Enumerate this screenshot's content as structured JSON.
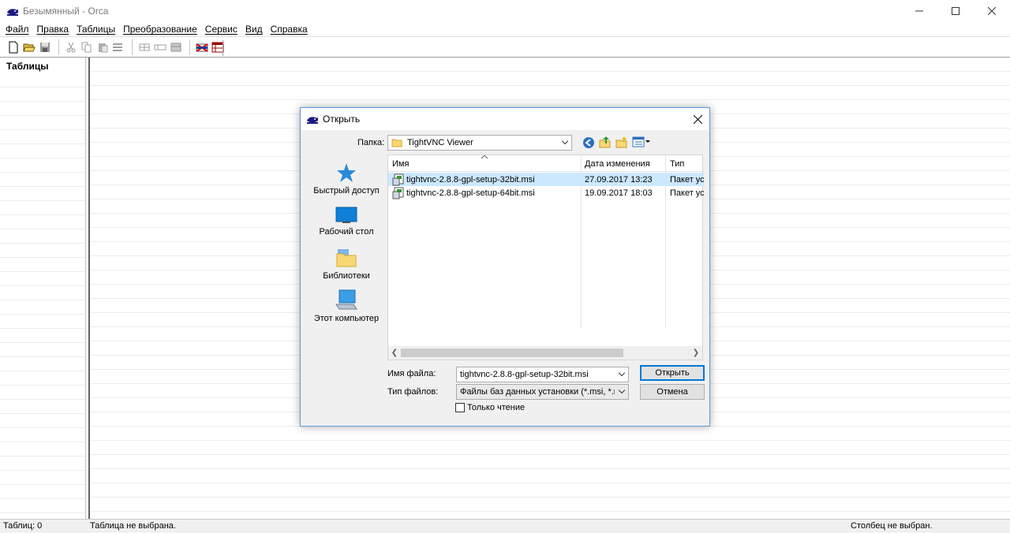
{
  "window": {
    "title": "Безымянный - Orca",
    "icon": "orca-whale-icon"
  },
  "menu": [
    "Файл",
    "Правка",
    "Таблицы",
    "Преобразование",
    "Сервис",
    "Вид",
    "Справка"
  ],
  "tables_pane": {
    "heading": "Таблицы"
  },
  "status": {
    "tables_count": "Таблиц: 0",
    "table_state": "Таблица не выбрана.",
    "column_state": "Столбец не выбран."
  },
  "dialog": {
    "title": "Открыть",
    "folder_label": "Папка:",
    "folder_value": "TightVNC Viewer",
    "places": [
      "Быстрый доступ",
      "Рабочий стол",
      "Библиотеки",
      "Этот компьютер"
    ],
    "columns": {
      "name": "Имя",
      "date": "Дата изменения",
      "type": "Тип"
    },
    "files": [
      {
        "name": "tightvnc-2.8.8-gpl-setup-32bit.msi",
        "date": "27.09.2017 13:23",
        "type": "Пакет уст"
      },
      {
        "name": "tightvnc-2.8.8-gpl-setup-64bit.msi",
        "date": "19.09.2017 18:03",
        "type": "Пакет уст"
      }
    ],
    "filename_label": "Имя файла:",
    "filename_value": "tightvnc-2.8.8-gpl-setup-32bit.msi",
    "filetype_label": "Тип файлов:",
    "filetype_value": "Файлы баз данных установки (*.msi, *.msm, *",
    "readonly_label": "Только чтение",
    "open_button": "Открыть",
    "cancel_button": "Отмена"
  },
  "colors": {
    "accent": "#0078d7",
    "selection": "#cce8ff",
    "dialog_border": "#5b9bd5"
  }
}
